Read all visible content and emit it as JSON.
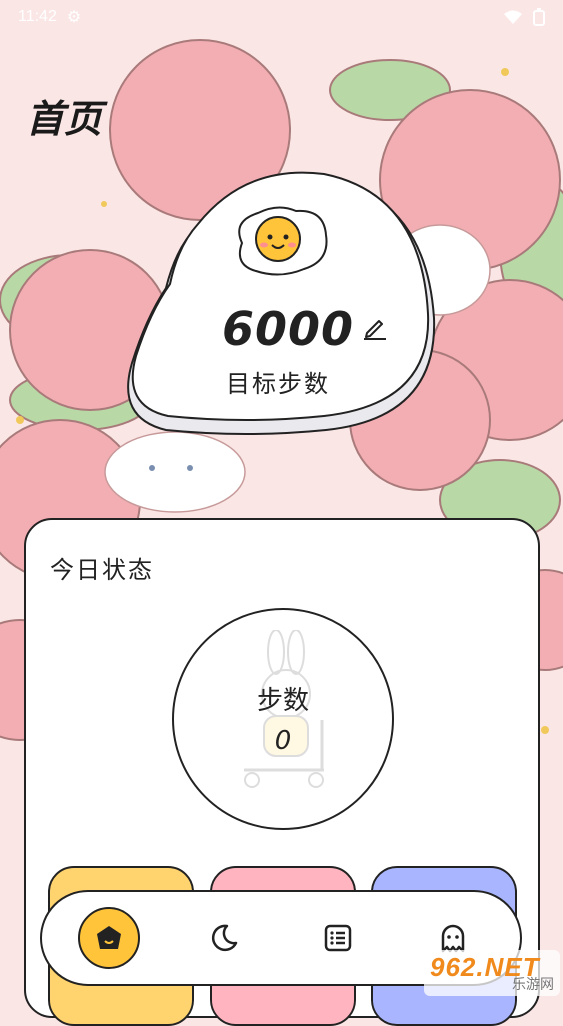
{
  "status_bar": {
    "time": "11:42",
    "extra": "⚙"
  },
  "header": {
    "title": "首页"
  },
  "goal": {
    "value": "6000",
    "label": "目标步数"
  },
  "today": {
    "title": "今日状态",
    "steps_label": "步数",
    "steps_value": "0"
  },
  "nav": {
    "items": [
      "home-icon",
      "moon-icon",
      "list-icon",
      "ghost-icon"
    ],
    "active": 0
  },
  "watermark": {
    "main": "962.NET",
    "sub": "乐游网"
  },
  "colors": {
    "accent": "#ffc43a",
    "card_yellow": "#ffd36e",
    "card_pink": "#ffb4bf",
    "card_blue": "#a9b6ff",
    "background": "#fbe6e6"
  }
}
